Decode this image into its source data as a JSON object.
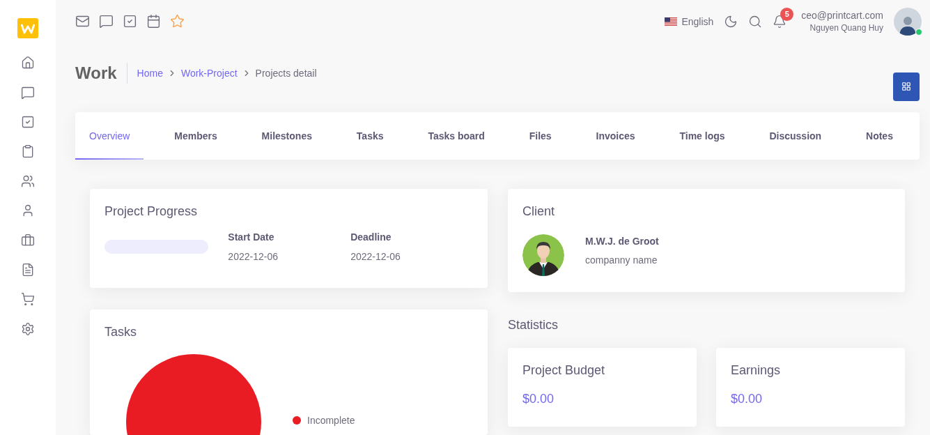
{
  "topbar": {
    "language": "English",
    "notification_count": "5",
    "user_email": "ceo@printcart.com",
    "user_name": "Nguyen Quang Huy",
    "online": true
  },
  "header": {
    "title": "Work",
    "breadcrumb": [
      {
        "label": "Home",
        "link": true
      },
      {
        "label": "Work-Project",
        "link": true
      },
      {
        "label": "Projects detail",
        "link": false
      }
    ]
  },
  "tabs": [
    {
      "label": "Overview",
      "selected": true
    },
    {
      "label": "Members",
      "selected": false
    },
    {
      "label": "Milestones",
      "selected": false
    },
    {
      "label": "Tasks",
      "selected": false
    },
    {
      "label": "Tasks board",
      "selected": false
    },
    {
      "label": "Files",
      "selected": false
    },
    {
      "label": "Invoices",
      "selected": false
    },
    {
      "label": "Time logs",
      "selected": false
    },
    {
      "label": "Discussion",
      "selected": false
    },
    {
      "label": "Notes",
      "selected": false
    }
  ],
  "project_progress": {
    "title": "Project Progress",
    "level": 0,
    "fields": [
      {
        "label": "Start Date",
        "value": "2022-12-06"
      },
      {
        "label": "Deadline",
        "value": "2022-12-06"
      }
    ]
  },
  "client": {
    "title": "Client",
    "name": "M.W.J. de Groot",
    "company": "companny name"
  },
  "statistics": {
    "title": "Statistics",
    "cards": [
      {
        "label": "Project Budget",
        "value": "$0.00"
      },
      {
        "label": "Earnings",
        "value": "$0.00"
      }
    ]
  },
  "tasks": {
    "title": "Tasks",
    "legend": [
      {
        "label": "Incomplete",
        "color": "#e91c24"
      }
    ]
  }
}
